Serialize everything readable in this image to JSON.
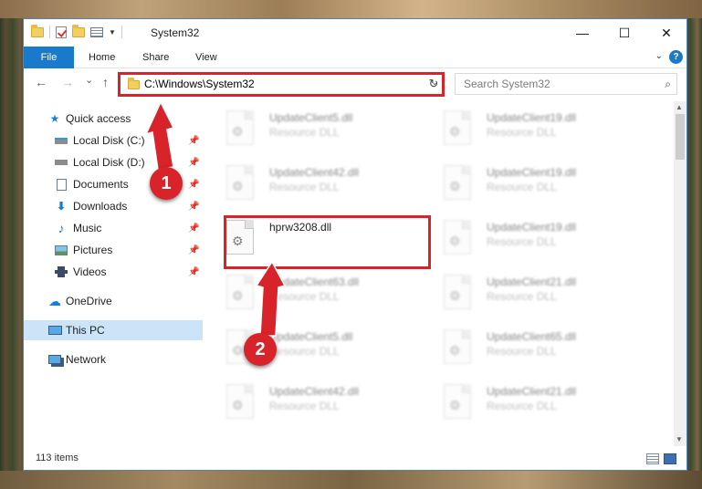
{
  "window": {
    "title": "System32",
    "controls": {
      "minimize": "—",
      "maximize": "☐",
      "close": "✕"
    }
  },
  "ribbon": {
    "tabs": [
      "File",
      "Home",
      "Share",
      "View"
    ],
    "help": "?"
  },
  "navigation": {
    "back": "←",
    "forward": "→",
    "recent": "⌄",
    "up": "↑",
    "address": "C:\\Windows\\System32",
    "refresh": "↻",
    "search_placeholder": "Search System32"
  },
  "sidebar": {
    "items": [
      {
        "label": "Quick access",
        "icon": "star-icon",
        "pinned": false
      },
      {
        "label": "Local Disk (C:)",
        "icon": "drive-icon",
        "pinned": true
      },
      {
        "label": "Local Disk (D:)",
        "icon": "drive-icon",
        "pinned": true
      },
      {
        "label": "Documents",
        "icon": "documents-icon",
        "pinned": true
      },
      {
        "label": "Downloads",
        "icon": "download-icon",
        "pinned": true
      },
      {
        "label": "Music",
        "icon": "music-icon",
        "pinned": true
      },
      {
        "label": "Pictures",
        "icon": "pictures-icon",
        "pinned": true
      },
      {
        "label": "Videos",
        "icon": "videos-icon",
        "pinned": true
      },
      {
        "label": "OneDrive",
        "icon": "cloud-icon",
        "pinned": false
      },
      {
        "label": "This PC",
        "icon": "computer-icon",
        "pinned": false,
        "selected": true
      },
      {
        "label": "Network",
        "icon": "network-icon",
        "pinned": false
      }
    ]
  },
  "files": {
    "left": [
      {
        "name": "UpdateClient5.dll",
        "type": "Resource DLL"
      },
      {
        "name": "UpdateClient42.dll",
        "type": "Resource DLL"
      },
      {
        "name": "hprw3208.dll",
        "type": ""
      },
      {
        "name": "UpdateClient63.dll",
        "type": "Resource DLL"
      },
      {
        "name": "UpdateClient5.dll",
        "type": "Resource DLL"
      },
      {
        "name": "UpdateClient42.dll",
        "type": "Resource DLL"
      }
    ],
    "right": [
      {
        "name": "UpdateClient19.dll",
        "type": "Resource DLL"
      },
      {
        "name": "UpdateClient19.dll",
        "type": "Resource DLL"
      },
      {
        "name": "UpdateClient19.dll",
        "type": "Resource DLL"
      },
      {
        "name": "UpdateClient21.dll",
        "type": "Resource DLL"
      },
      {
        "name": "UpdateClient65.dll",
        "type": "Resource DLL"
      },
      {
        "name": "UpdateClient21.dll",
        "type": "Resource DLL"
      }
    ]
  },
  "status": {
    "item_count": "113 items"
  },
  "annotations": {
    "step1": "1",
    "step2": "2",
    "color": "#d8232a"
  }
}
